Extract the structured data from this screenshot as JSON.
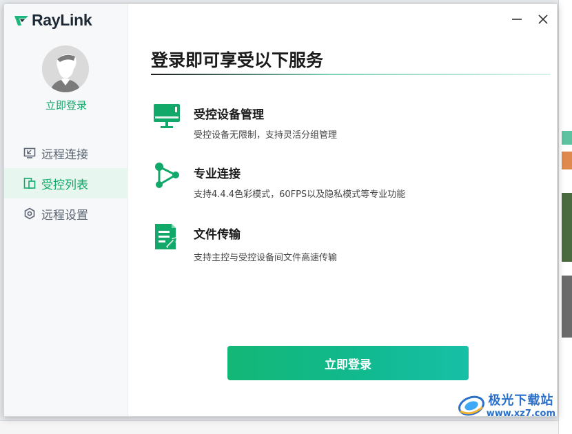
{
  "app": {
    "name": "RayLink",
    "brand_color": "#11a86a"
  },
  "sidebar": {
    "login_label": "立即登录",
    "items": [
      {
        "label": "远程连接",
        "icon": "remote-connect-icon",
        "active": false
      },
      {
        "label": "受控列表",
        "icon": "device-list-icon",
        "active": true
      },
      {
        "label": "远程设置",
        "icon": "settings-hex-icon",
        "active": false
      }
    ]
  },
  "window_controls": {
    "minimize": "minimize-icon",
    "close": "close-icon"
  },
  "main": {
    "title": "登录即可享受以下服务",
    "features": [
      {
        "icon": "monitor-icon",
        "title": "受控设备管理",
        "desc": "受控设备无限制，支持灵活分组管理"
      },
      {
        "icon": "share-nodes-icon",
        "title": "专业连接",
        "desc": "支持4.4.4色彩模式，60FPS以及隐私模式等专业功能"
      },
      {
        "icon": "file-transfer-icon",
        "title": "文件传输",
        "desc": "支持主控与受控设备间文件高速传输"
      }
    ],
    "login_button": "立即登录"
  },
  "watermark": {
    "title": "极光下载站",
    "url": "www.xz7.com"
  }
}
